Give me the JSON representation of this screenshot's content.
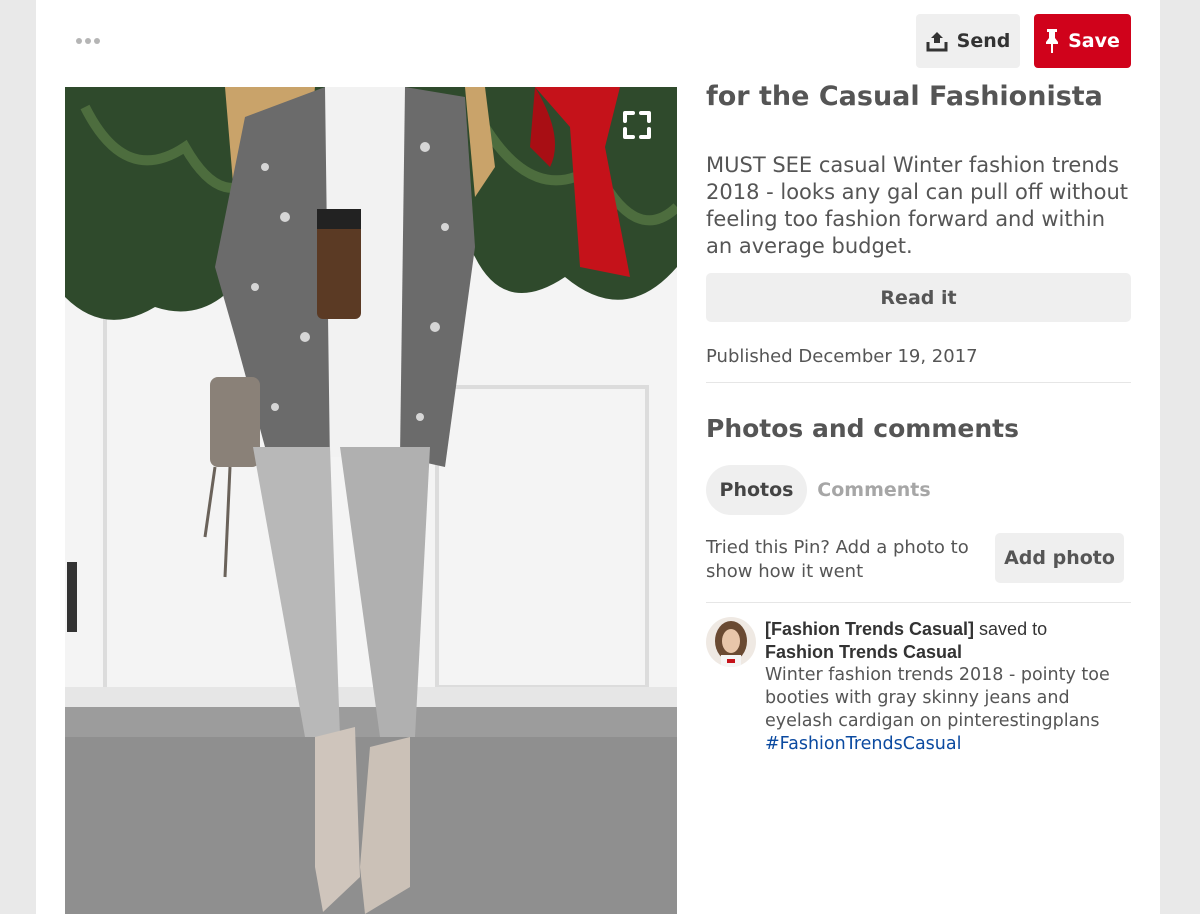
{
  "header": {
    "send_label": "Send",
    "save_label": "Save",
    "more_icon": "ellipsis-icon",
    "send_icon": "share-upload-icon",
    "save_icon": "pushpin-icon",
    "save_color": "#d0021b"
  },
  "pin": {
    "title": "for the Casual Fashionista",
    "description": "MUST SEE casual Winter fashion trends 2018 - looks any gal can pull off without feeling too fashion forward and within an average budget.",
    "read_it_label": "Read it",
    "published": "Published December 19, 2017",
    "expand_icon": "expand-icon"
  },
  "photos_section": {
    "heading": "Photos and comments",
    "tabs": [
      {
        "label": "Photos",
        "active": true
      },
      {
        "label": "Comments",
        "active": false
      }
    ],
    "tried_text": "Tried this Pin? Add a photo to show how it went",
    "add_photo_label": "Add photo"
  },
  "saved_by": {
    "user": "[Fashion Trends Casual]",
    "saved_to": " saved to",
    "board": "Fashion Trends Casual",
    "text": "Winter fashion trends 2018 - pointy toe booties with gray skinny jeans and eyelash cardigan on pinterestingplans",
    "hashtag": "#FashionTrendsCasual",
    "hashtag_color": "#0b4aa0"
  }
}
